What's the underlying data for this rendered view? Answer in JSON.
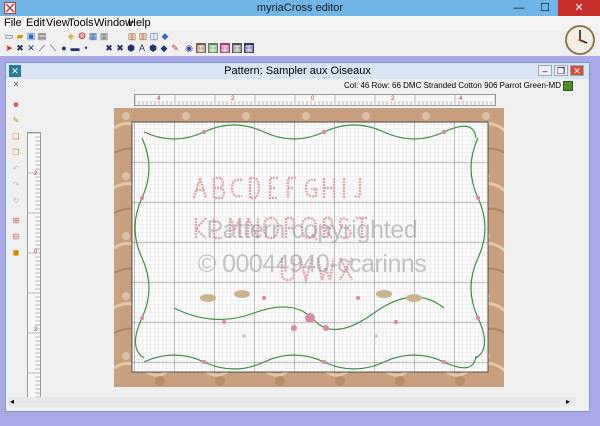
{
  "app": {
    "title": "myriaCross editor"
  },
  "window_controls": {
    "minimize": "—",
    "maximize": "☐",
    "close": "✕"
  },
  "menu": [
    "File",
    "Edit",
    "View",
    "Tools",
    "Window",
    "Help"
  ],
  "document": {
    "title": "Pattern: Sampler aux Oiseaux",
    "status": "Col: 46  Row: 66  DMC Stranded Cotton 906 Parrot Green-MD",
    "watermark_line1": "Pattern copyrighted",
    "watermark_line2": "© 00044940-ccarinns"
  },
  "ruler": {
    "h_labels": [
      "4",
      "2",
      "0",
      "2",
      "4"
    ],
    "v_labels": [
      "2",
      "0",
      "2"
    ]
  },
  "colors": {
    "accent": "#6fb5e6",
    "close": "#c7302a",
    "mdi_bg": "#a9a9e8",
    "frame": "#c9a07f",
    "thread": "#4f8c2a"
  }
}
